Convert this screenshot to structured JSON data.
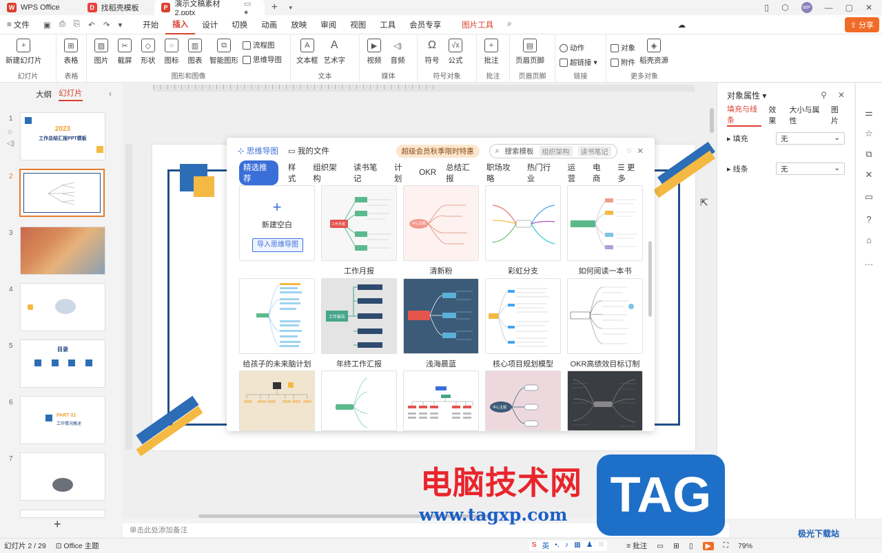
{
  "titlebar": {
    "tabs": [
      {
        "label": "WPS Office",
        "logo": "W"
      },
      {
        "label": "找稻壳模板",
        "logo": "D"
      },
      {
        "label": "演示文稿素材2.pptx",
        "logo": "P"
      }
    ],
    "new_tab": "+",
    "avatar": "WP"
  },
  "menubar": {
    "file": "文件",
    "tabs": [
      "开始",
      "插入",
      "设计",
      "切换",
      "动画",
      "放映",
      "审阅",
      "视图",
      "工具",
      "会员专享"
    ],
    "active": "插入",
    "picture_tools": "图片工具",
    "share": "分享"
  },
  "ribbon": {
    "new_slide": "新建幻灯片",
    "new_slide_group": "幻灯片",
    "table": "表格",
    "table_group": "表格",
    "picture": "图片",
    "screenshot": "截屏",
    "shape": "形状",
    "icon": "图标",
    "chart": "图表",
    "smart_graphic": "智能图形",
    "flowchart": "流程图",
    "mindmap": "思维导图",
    "graphics_group": "图形和图像",
    "textbox": "文本框",
    "wordart": "艺术字",
    "text_group": "文本",
    "video": "视频",
    "audio": "音频",
    "media_group": "媒体",
    "symbol": "符号",
    "formula": "公式",
    "symbol_group": "符号对象",
    "comment": "批注",
    "comment_group": "批注",
    "header_footer": "页眉页脚",
    "header_footer_group": "页眉页脚",
    "action": "动作",
    "hyperlink": "超链接",
    "link_group": "链接",
    "object": "对象",
    "attachment": "附件",
    "daoke": "稻壳资源",
    "more_group": "更多对象"
  },
  "leftpanel": {
    "tab_outline": "大纲",
    "tab_slides": "幻灯片",
    "slide_numbers": [
      "1",
      "2",
      "3",
      "4",
      "5",
      "6",
      "7"
    ],
    "slide1_year": "2023",
    "slide1_title": "工作总结汇报PPT模板",
    "slide5_title": "目录",
    "slide6_part": "PART 01",
    "slide6_title": "工作情况概述",
    "add": "+"
  },
  "dialog": {
    "tab_mindmap": "思维导图",
    "tab_myfiles": "我的文件",
    "promo": "超级会员秋季限时特惠",
    "search_placeholder": "搜索模板",
    "search_chip1": "组织架构",
    "search_chip2": "读书笔记",
    "categories": [
      "精选推荐",
      "样式",
      "组织架构",
      "读书笔记",
      "计划",
      "OKR",
      "总结汇报",
      "职场攻略",
      "热门行业",
      "运营",
      "电商"
    ],
    "more": "更多",
    "new_blank": "新建空白",
    "import": "导入思维导图",
    "templates": [
      "工作月报",
      "清新粉",
      "彩虹分支",
      "如何阅读一本书",
      "给孩子的未来脑计划",
      "年终工作汇报",
      "浅海晨蓝",
      "核心项目规划模型",
      "OKR高绩效目标订制模板"
    ],
    "node_work": "工作月报",
    "node_center": "中心主题",
    "node_report": "工作报告"
  },
  "rightpanel": {
    "title": "对象属性",
    "tabs": [
      "填充与线条",
      "效果",
      "大小与属性",
      "图片"
    ],
    "fill_label": "填充",
    "fill_value": "无",
    "line_label": "线条",
    "line_value": "无"
  },
  "notes": {
    "placeholder": "单击此处添加备注"
  },
  "statusbar": {
    "slide_info": "幻灯片 2 / 29",
    "theme": "Office 主题",
    "ime": "英",
    "comment": "批注",
    "zoom": "79%"
  },
  "watermark": {
    "cn": "电脑技术网",
    "url": "www.tagxp.com",
    "tag": "TAG",
    "xz": "极光下载站"
  }
}
